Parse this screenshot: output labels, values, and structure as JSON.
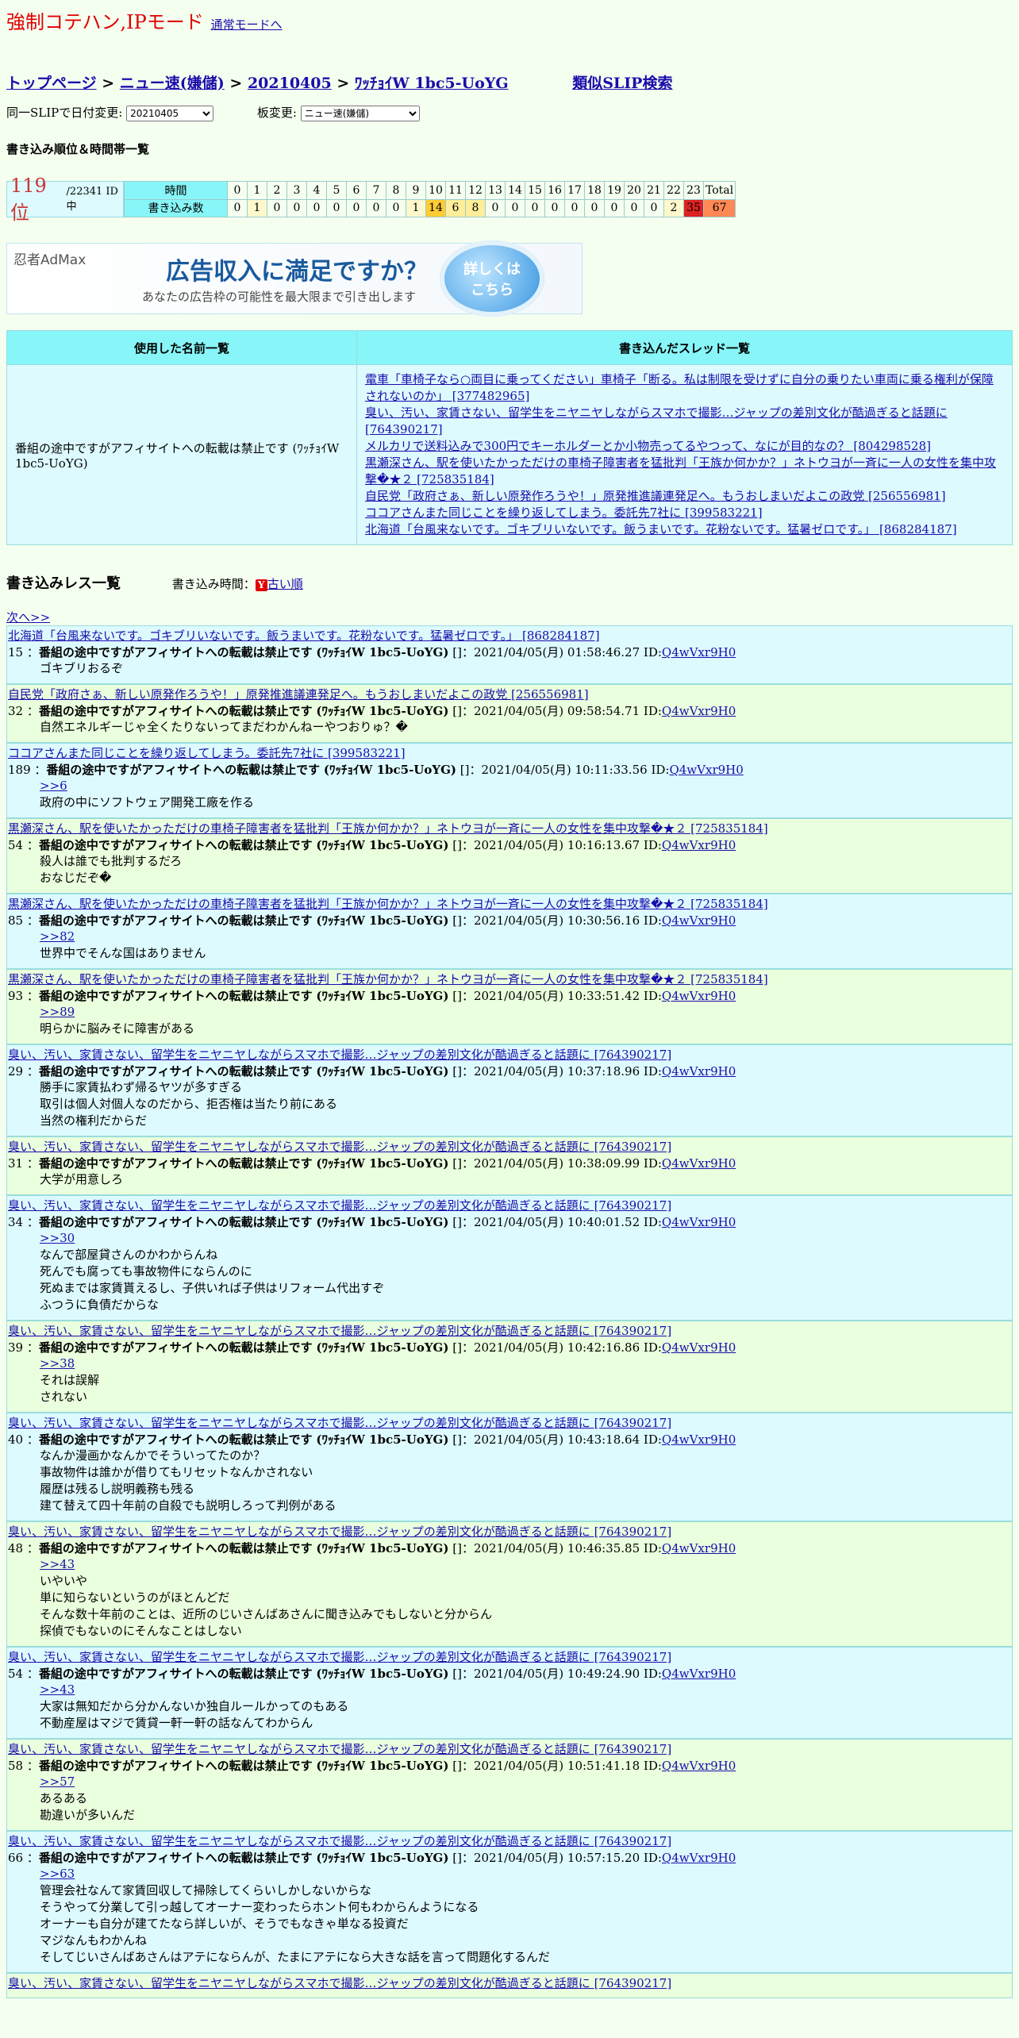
{
  "mode": {
    "title": "強制コテハン,IPモード",
    "link": "通常モードへ"
  },
  "breadcrumb": {
    "top": "トップページ",
    "board": "ニュー速(嫌儲)",
    "date": "20210405",
    "slip": "ﾜｯﾁｮｲW 1bc5-UoYG",
    "similar": "類似SLIP検索",
    "sep": ">"
  },
  "form": {
    "date_label": "同一SLIPで日付変更:",
    "date_value": "20210405",
    "board_label": "板変更:",
    "board_value": "ニュー速(嫌儲)"
  },
  "ranking": {
    "heading": "書き込み順位＆時間帯一覧",
    "rank": "119 位",
    "total": "/22341 ID中",
    "time_label": "時間",
    "count_label": "書き込み数",
    "hours": [
      "0",
      "1",
      "2",
      "3",
      "4",
      "5",
      "6",
      "7",
      "8",
      "9",
      "10",
      "11",
      "12",
      "13",
      "14",
      "15",
      "16",
      "17",
      "18",
      "19",
      "20",
      "21",
      "22",
      "23",
      "Total"
    ],
    "counts": [
      "0",
      "1",
      "0",
      "0",
      "0",
      "0",
      "0",
      "0",
      "0",
      "1",
      "14",
      "6",
      "8",
      "0",
      "0",
      "0",
      "0",
      "0",
      "0",
      "0",
      "0",
      "0",
      "2",
      "35",
      "67"
    ],
    "count_colors": [
      "",
      "#fff8cc",
      "",
      "",
      "",
      "",
      "",
      "",
      "",
      "#fff8cc",
      "#ffcc33",
      "#ffee99",
      "#ffee99",
      "",
      "",
      "",
      "",
      "",
      "",
      "",
      "",
      "",
      "#fff8cc",
      "#dd2222",
      "#ff8855"
    ]
  },
  "ad": {
    "brand": "忍者AdMax",
    "main": "広告収入に満足ですか？",
    "sub": "あなたの広告枠の可能性を最大限まで引き出します",
    "badge_line1": "詳しくは",
    "badge_line2": "こちら"
  },
  "names_table": {
    "col_names": "使用した名前一覧",
    "col_threads": "書き込んだスレッド一覧",
    "name": "番組の途中ですがアフィサイトへの転載は禁止です (ﾜｯﾁｮｲW 1bc5-UoYG)",
    "threads": [
      "電車「車椅子なら○両目に乗ってください」車椅子「断る。私は制限を受けずに自分の乗りたい車両に乗る権利が保障されないのか」 [377482965]",
      "臭い、汚い、家賃さない、留学生をニヤニヤしながらスマホで撮影…ジャップの差別文化が酷過ぎると話題に [764390217]",
      "メルカリで送料込みで300円でキーホルダーとか小物売ってるやつって、なにが目的なの？ [804298528]",
      "黒瀬深さん、駅を使いたかっただけの車椅子障害者を猛批判「王族か何かか？」ネトウヨが一斉に一人の女性を集中攻撃�★２ [725835184]",
      "自民党「政府さぁ、新しい原発作ろうや！」原発推進議連発足へ。もうおしまいだよこの政党 [256556981]",
      "ココアさんまた同じことを繰り返してしまう。委託先7社に [399583221]",
      "北海道「台風来ないです。ゴキブリいないです。飯うまいです。花粉ないです。猛暑ゼロです。」 [868284187]"
    ]
  },
  "res_section": {
    "title": "書き込みレス一覧",
    "time_label": "書き込み時間：",
    "y_icon": "Y",
    "order_link": "古い順",
    "next": "次へ>>"
  },
  "posts": [
    {
      "thread": "北海道「台風来ないです。ゴキブリいないです。飯うまいです。花粉ないです。猛暑ゼロです。」 [868284187]",
      "num": "15",
      "date": "2021/04/05(月) 01:58:46.27",
      "body": [
        "ゴキブリおるぞ"
      ]
    },
    {
      "thread": "自民党「政府さぁ、新しい原発作ろうや！」原発推進議連発足へ。もうおしまいだよこの政党 [256556981]",
      "num": "32",
      "date": "2021/04/05(月) 09:58:54.71",
      "body": [
        "自然エネルギーじゃ全くたりないってまだわかんねーやつおりゅ？�"
      ]
    },
    {
      "thread": "ココアさんまた同じことを繰り返してしまう。委託先7社に [399583221]",
      "num": "189",
      "date": "2021/04/05(月) 10:11:33.56",
      "anchor": ">>6",
      "body": [
        "政府の中にソフトウェア開発工廠を作る"
      ]
    },
    {
      "thread": "黒瀬深さん、駅を使いたかっただけの車椅子障害者を猛批判「王族か何かか？」ネトウヨが一斉に一人の女性を集中攻撃�★２ [725835184]",
      "num": "54",
      "date": "2021/04/05(月) 10:16:13.67",
      "body": [
        "殺人は誰でも批判するだろ",
        "おなじだぞ�"
      ]
    },
    {
      "thread": "黒瀬深さん、駅を使いたかっただけの車椅子障害者を猛批判「王族か何かか？」ネトウヨが一斉に一人の女性を集中攻撃�★２ [725835184]",
      "num": "85",
      "date": "2021/04/05(月) 10:30:56.16",
      "anchor": ">>82",
      "body": [
        "世界中でそんな国はありません"
      ]
    },
    {
      "thread": "黒瀬深さん、駅を使いたかっただけの車椅子障害者を猛批判「王族か何かか？」ネトウヨが一斉に一人の女性を集中攻撃�★２ [725835184]",
      "num": "93",
      "date": "2021/04/05(月) 10:33:51.42",
      "anchor": ">>89",
      "body": [
        "明らかに脳みそに障害がある"
      ]
    },
    {
      "thread": "臭い、汚い、家賃さない、留学生をニヤニヤしながらスマホで撮影…ジャップの差別文化が酷過ぎると話題に [764390217]",
      "num": "29",
      "date": "2021/04/05(月) 10:37:18.96",
      "body": [
        "勝手に家賃払わず帰るヤツが多すぎる",
        "取引は個人対個人なのだから、拒否権は当たり前にある",
        "当然の権利だからだ"
      ]
    },
    {
      "thread": "臭い、汚い、家賃さない、留学生をニヤニヤしながらスマホで撮影…ジャップの差別文化が酷過ぎると話題に [764390217]",
      "num": "31",
      "date": "2021/04/05(月) 10:38:09.99",
      "body": [
        "大学が用意しろ"
      ]
    },
    {
      "thread": "臭い、汚い、家賃さない、留学生をニヤニヤしながらスマホで撮影…ジャップの差別文化が酷過ぎると話題に [764390217]",
      "num": "34",
      "date": "2021/04/05(月) 10:40:01.52",
      "anchor": ">>30",
      "body": [
        "なんで部屋貸さんのかわからんね",
        "死んでも腐っても事故物件にならんのに",
        "死ぬまでは家賃貰えるし、子供いれば子供はリフォーム代出すぞ",
        "ふつうに負債だからな"
      ]
    },
    {
      "thread": "臭い、汚い、家賃さない、留学生をニヤニヤしながらスマホで撮影…ジャップの差別文化が酷過ぎると話題に [764390217]",
      "num": "39",
      "date": "2021/04/05(月) 10:42:16.86",
      "anchor": ">>38",
      "body": [
        "それは誤解",
        "されない"
      ]
    },
    {
      "thread": "臭い、汚い、家賃さない、留学生をニヤニヤしながらスマホで撮影…ジャップの差別文化が酷過ぎると話題に [764390217]",
      "num": "40",
      "date": "2021/04/05(月) 10:43:18.64",
      "body": [
        "なんか漫画かなんかでそういってたのか？",
        "事故物件は誰かが借りてもリセットなんかされない",
        "履歴は残るし説明義務も残る",
        "建て替えて四十年前の自殺でも説明しろって判例がある"
      ]
    },
    {
      "thread": "臭い、汚い、家賃さない、留学生をニヤニヤしながらスマホで撮影…ジャップの差別文化が酷過ぎると話題に [764390217]",
      "num": "48",
      "date": "2021/04/05(月) 10:46:35.85",
      "anchor": ">>43",
      "body": [
        "いやいや",
        "単に知らないというのがほとんどだ",
        "そんな数十年前のことは、近所のじいさんばあさんに聞き込みでもしないと分からん",
        "探偵でもないのにそんなことはしない"
      ]
    },
    {
      "thread": "臭い、汚い、家賃さない、留学生をニヤニヤしながらスマホで撮影…ジャップの差別文化が酷過ぎると話題に [764390217]",
      "num": "54",
      "date": "2021/04/05(月) 10:49:24.90",
      "anchor": ">>43",
      "body": [
        "大家は無知だから分かんないか独自ルールかってのもある",
        "不動産屋はマジで賃貸一軒一軒の話なんてわからん"
      ]
    },
    {
      "thread": "臭い、汚い、家賃さない、留学生をニヤニヤしながらスマホで撮影…ジャップの差別文化が酷過ぎると話題に [764390217]",
      "num": "58",
      "date": "2021/04/05(月) 10:51:41.18",
      "anchor": ">>57",
      "body": [
        "あるある",
        "勘違いが多いんだ"
      ]
    },
    {
      "thread": "臭い、汚い、家賃さない、留学生をニヤニヤしながらスマホで撮影…ジャップの差別文化が酷過ぎると話題に [764390217]",
      "num": "66",
      "date": "2021/04/05(月) 10:57:15.20",
      "anchor": ">>63",
      "body": [
        "管理会社なんて家賃回収して掃除してくらいしかしないからな",
        "そうやって分業して引っ越してオーナー変わったらホント何もわからんようになる",
        "オーナーも自分が建てたなら詳しいが、そうでもなきゃ単なる投資だ",
        "マジなんもわかんね",
        "そしてじいさんばあさんはアテにならんが、たまにアテになら大きな話を言って問題化するんだ"
      ]
    },
    {
      "thread": "臭い、汚い、家賃さない、留学生をニヤニヤしながらスマホで撮影…ジャップの差別文化が酷過ぎると話題に [764390217]",
      "num": "",
      "date": "",
      "body": []
    }
  ],
  "post_label": {
    "name": "番組の途中ですがアフィサイトへの転載は禁止です",
    "slip": "(ﾜｯﾁｮｲW 1bc5-UoYG)",
    "bracket": "[]",
    "id_prefix": "ID:",
    "id": "Q4wVxr9H0"
  }
}
